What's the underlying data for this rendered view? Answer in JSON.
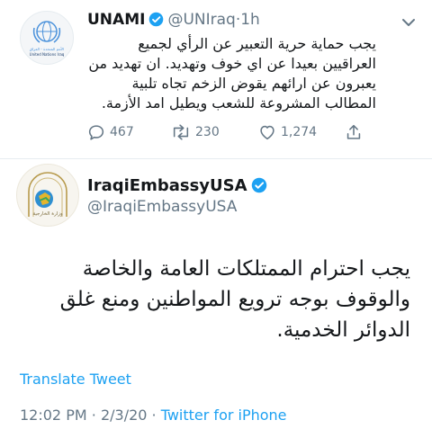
{
  "quoted_tweet": {
    "display_name": "UNAMI",
    "handle": "@UNIraq",
    "separator": "·",
    "time": "1h",
    "avatar_caption": "United Nations Iraq",
    "avatar_caption_ar": "الأمم المتحدة - العراق",
    "text": "يجب حماية حرية التعبير عن الرأي لجميع العراقيين بعيدا عن اي خوف وتهديد. ان تهديد من يعبرون عن ارائهم يقوض الزخم تجاه تلبية المطالب المشروعة للشعب ويطيل امد الأزمة.",
    "reply_count": "467",
    "retweet_count": "230",
    "like_count": "1,274",
    "icons": [
      "reply-icon",
      "retweet-icon",
      "like-icon",
      "share-icon",
      "chevron-down-icon",
      "verified-badge-icon"
    ]
  },
  "tweet": {
    "display_name": "IraqiEmbassyUSA",
    "handle": "@IraqiEmbassyUSA",
    "avatar_caption": "وزارة الخارجية",
    "text": "يجب احترام الممتلكات العامة والخاصة والوقوف بوجه ترويع المواطنين ومنع غلق الدوائر الخدمية.",
    "translate_label": "Translate Tweet",
    "time": "12:02 PM",
    "separator": "·",
    "date": "2/3/20",
    "source": "Twitter for iPhone"
  },
  "colors": {
    "link": "#1da1f2",
    "secondary_text": "#657786",
    "verified": "#1da1f2",
    "divider": "#e6ecf0"
  }
}
